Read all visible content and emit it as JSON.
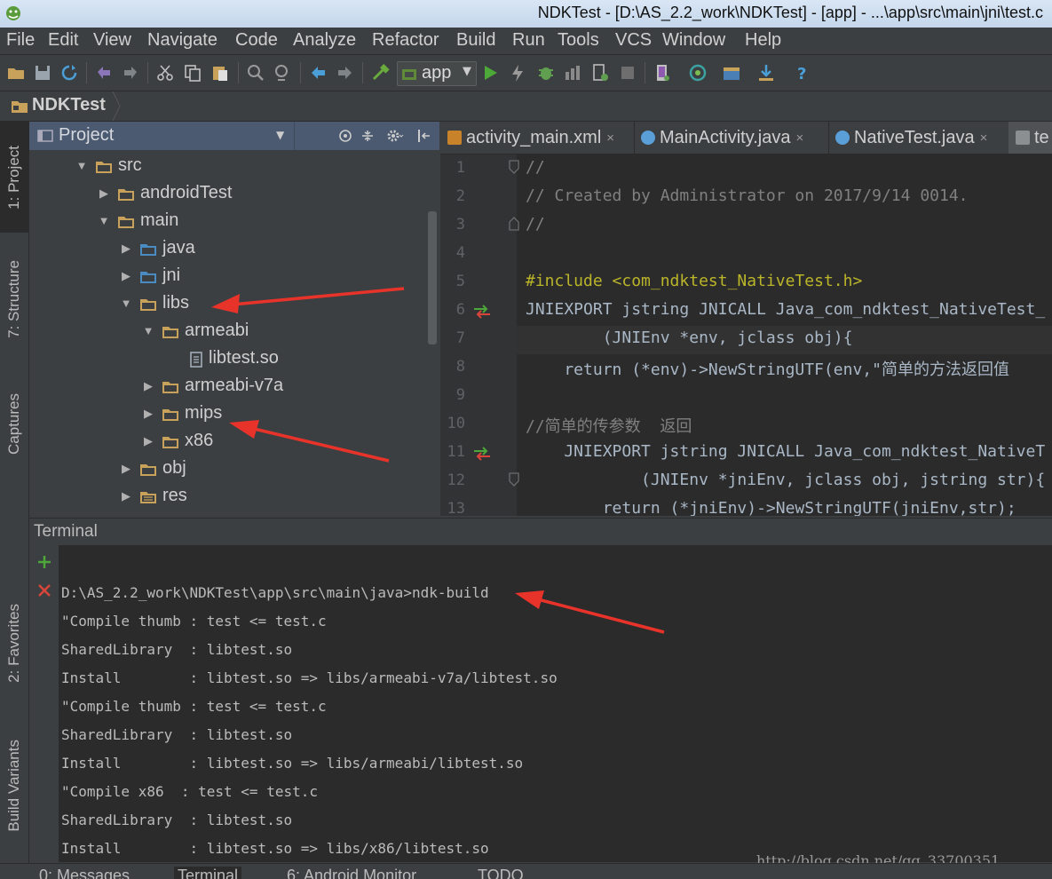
{
  "window": {
    "title": "NDKTest - [D:\\AS_2.2_work\\NDKTest] - [app] - ...\\app\\src\\main\\jni\\test.c"
  },
  "menu": [
    "File",
    "Edit",
    "View",
    "Navigate",
    "Code",
    "Analyze",
    "Refactor",
    "Build",
    "Run",
    "Tools",
    "VCS",
    "Window",
    "Help"
  ],
  "toolbar": {
    "run_config": "app",
    "icons": [
      "open-folder-icon",
      "save-icon",
      "sync-icon",
      "undo-icon",
      "redo-icon",
      "cut-icon",
      "copy-icon",
      "paste-icon",
      "find-icon",
      "replace-icon",
      "back-icon",
      "forward-icon",
      "make-project-icon",
      "run-icon",
      "apply-changes-icon",
      "debug-icon",
      "profile-icon",
      "attach-debugger-icon",
      "stop-icon",
      "avd-manager-icon",
      "sdk-manager-icon",
      "project-structure-icon",
      "download-icon",
      "help-icon"
    ]
  },
  "navbar": {
    "project": "NDKTest"
  },
  "left_strip": {
    "tabs": [
      "1: Project",
      "7: Structure",
      "Captures",
      "2: Favorites",
      "Build Variants"
    ]
  },
  "project_panel": {
    "view": "Project",
    "tree": [
      {
        "label": "src",
        "state": "expanded"
      },
      {
        "label": "androidTest",
        "state": "collapsed"
      },
      {
        "label": "main",
        "state": "expanded"
      },
      {
        "label": "java",
        "state": "collapsed"
      },
      {
        "label": "jni",
        "state": "collapsed"
      },
      {
        "label": "libs",
        "state": "expanded"
      },
      {
        "label": "armeabi",
        "state": "expanded"
      },
      {
        "label": "libtest.so",
        "state": "file"
      },
      {
        "label": "armeabi-v7a",
        "state": "collapsed"
      },
      {
        "label": "mips",
        "state": "collapsed"
      },
      {
        "label": "x86",
        "state": "collapsed"
      },
      {
        "label": "obj",
        "state": "collapsed"
      },
      {
        "label": "res",
        "state": "collapsed"
      }
    ]
  },
  "editor": {
    "tabs": [
      {
        "label": "activity_main.xml",
        "close": "×"
      },
      {
        "label": "MainActivity.java",
        "close": "×"
      },
      {
        "label": "NativeTest.java",
        "close": "×"
      },
      {
        "label": "te",
        "close": ""
      }
    ],
    "line_numbers": [
      "1",
      "2",
      "3",
      "4",
      "5",
      "6",
      "7",
      "8",
      "9",
      "10",
      "11",
      "12",
      "13"
    ],
    "lines": [
      "//",
      "// Created by Administrator on 2017/9/14 0014.",
      "//",
      "",
      "#include <com_ndktest_NativeTest.h>",
      "JNIEXPORT jstring JNICALL Java_com_ndktest_NativeTest_",
      "        (JNIEnv *env, jclass obj){",
      "    return (*env)->NewStringUTF(env,\"简单的方法返回值",
      "",
      "//简单的传参数  返回",
      "    JNIEXPORT jstring JNICALL Java_com_ndktest_NativeT",
      "            (JNIEnv *jniEnv, jclass obj, jstring str){",
      "        return (*jniEnv)->NewStringUTF(jniEnv,str);"
    ]
  },
  "terminal": {
    "title": "Terminal",
    "lines": [
      "D:\\AS_2.2_work\\NDKTest\\app\\src\\main\\java>ndk-build",
      "\"Compile thumb : test <= test.c",
      "SharedLibrary  : libtest.so",
      "Install        : libtest.so => libs/armeabi-v7a/libtest.so",
      "\"Compile thumb : test <= test.c",
      "SharedLibrary  : libtest.so",
      "Install        : libtest.so => libs/armeabi/libtest.so",
      "\"Compile x86  : test <= test.c",
      "SharedLibrary  : libtest.so",
      "Install        : libtest.so => libs/x86/libtest.so"
    ],
    "watermark": "http://blog.csdn.net/qq_33700351"
  },
  "bottom_tabs": [
    "0: Messages",
    "Terminal",
    "6: Android Monitor",
    "TODO"
  ],
  "colors": {
    "accent_header": "#4b5a70",
    "annotation_arrow": "#e8332a",
    "folder": "#c8a25a"
  }
}
